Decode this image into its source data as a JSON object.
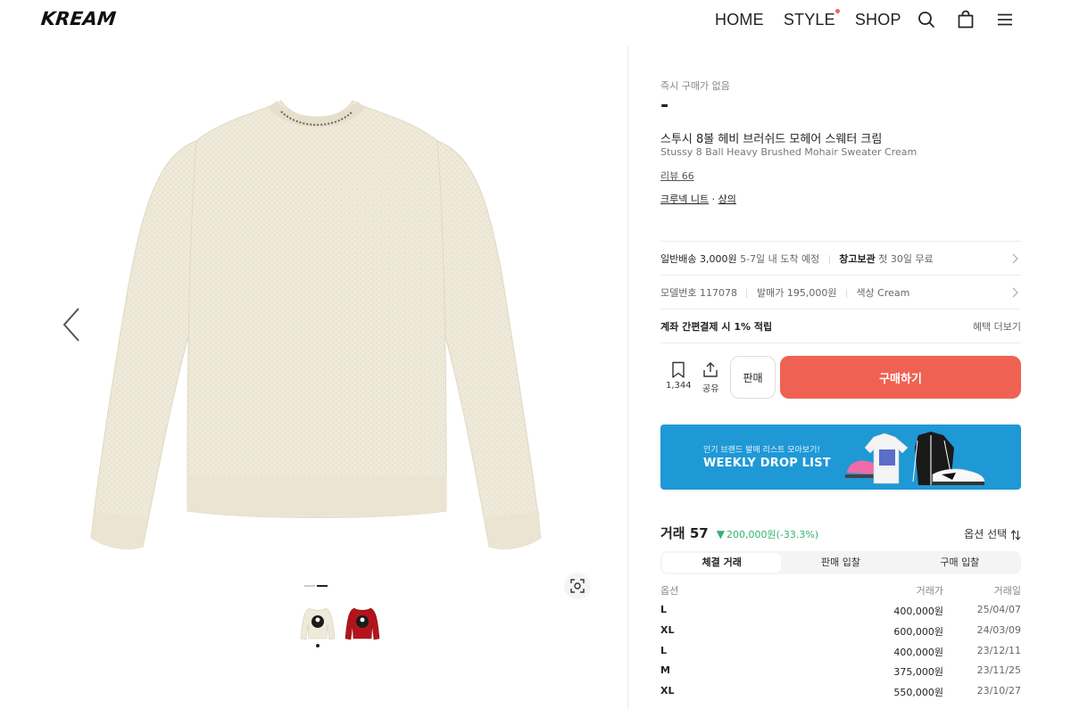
{
  "header": {
    "logo": "KREAM",
    "nav": [
      "HOME",
      "STYLE",
      "SHOP"
    ]
  },
  "product": {
    "status": "즉시 구매가 없음",
    "price": "-",
    "title_ko": "스투시 8볼 헤비 브러쉬드 모헤어 스웨터 크림",
    "title_en": "Stussy 8 Ball Heavy Brushed Mohair Sweater Cream",
    "review": "리뷰 66",
    "category1": "크루넥 니트",
    "separator": "·",
    "category2": "상의"
  },
  "info": {
    "delivery_label": "일반배송 3,000원",
    "delivery_eta": "5-7일 내 도착 예정",
    "storage_label": "창고보관",
    "storage_detail": "첫 30일 무료",
    "model_no": "모델번호 117078",
    "release_price": "발매가 195,000원",
    "color": "색상 Cream",
    "benefit": "계좌 간편결제 시 1% 적립",
    "benefit_more": "혜택 더보기"
  },
  "actions": {
    "bookmark_count": "1,344",
    "share_label": "공유",
    "sell_label": "판매",
    "buy_label": "구매하기"
  },
  "banner": {
    "subtitle": "인기 브랜드 발매 리스트 모아보기!",
    "title": "WEEKLY DROP LIST"
  },
  "trades": {
    "title": "거래 57",
    "change": "200,000원(-33.3%)",
    "option_select": "옵션 선택",
    "tabs": [
      "체결 거래",
      "판매 입찰",
      "구매 입찰"
    ],
    "active_tab": 0,
    "columns": [
      "옵션",
      "거래가",
      "거래일"
    ],
    "rows": [
      {
        "option": "L",
        "price": "400,000원",
        "date": "25/04/07"
      },
      {
        "option": "XL",
        "price": "600,000원",
        "date": "24/03/09"
      },
      {
        "option": "L",
        "price": "400,000원",
        "date": "23/12/11"
      },
      {
        "option": "M",
        "price": "375,000원",
        "date": "23/11/25"
      },
      {
        "option": "XL",
        "price": "550,000원",
        "date": "23/10/27"
      }
    ]
  },
  "colors": {
    "accent": "#ef6253",
    "banner": "#1f98d6",
    "positive": "#31b46e",
    "sweater": "#efe9d9",
    "thumb_red": "#b3141b"
  }
}
